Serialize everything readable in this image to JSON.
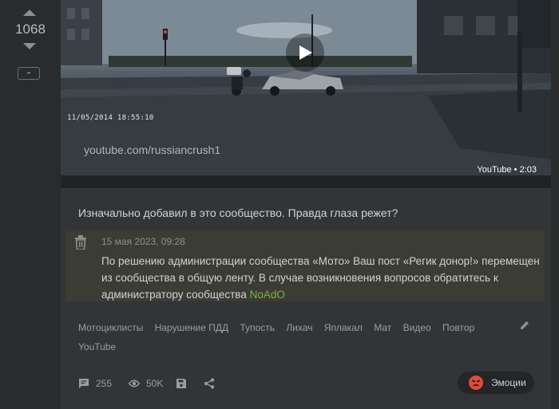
{
  "rating": {
    "value": "1068",
    "collapse_label": "-"
  },
  "video": {
    "timestamp": "11/05/2014 18:55:10",
    "watermark": "youtube.com/russiancrush1",
    "badge": "YouTube • 2:03"
  },
  "post": {
    "text": "Изначально добавил в это сообщество. Правда глаза режет?"
  },
  "notice": {
    "date": "15 мая 2023, 09:28",
    "text": "По решению администрации сообщества «Мото» Ваш пост «Регик донор!» перемещен из сообщества в общую ленту. В случае возникновения вопросов обратитесь к администратору сообщества ",
    "link": "NoAdO"
  },
  "tags": [
    "Мотоциклисты",
    "Нарушение ПДД",
    "Тупость",
    "Лихач",
    "Яплакал",
    "Мат",
    "Видео",
    "Повтор",
    "YouTube"
  ],
  "footer": {
    "comments": "255",
    "views": "50K",
    "emotions_label": "Эмоции"
  },
  "colors": {
    "background": "#2b2c2d",
    "post_background": "#333436",
    "notice_background": "#3b3c33",
    "link_green": "#7fb04a",
    "emotion_red": "#e04a3a"
  },
  "icons": [
    "chevron-up-icon",
    "chevron-down-icon",
    "play-icon",
    "trash-icon",
    "pencil-icon",
    "comment-icon",
    "eye-icon",
    "save-icon",
    "share-icon",
    "angry-face-icon"
  ]
}
